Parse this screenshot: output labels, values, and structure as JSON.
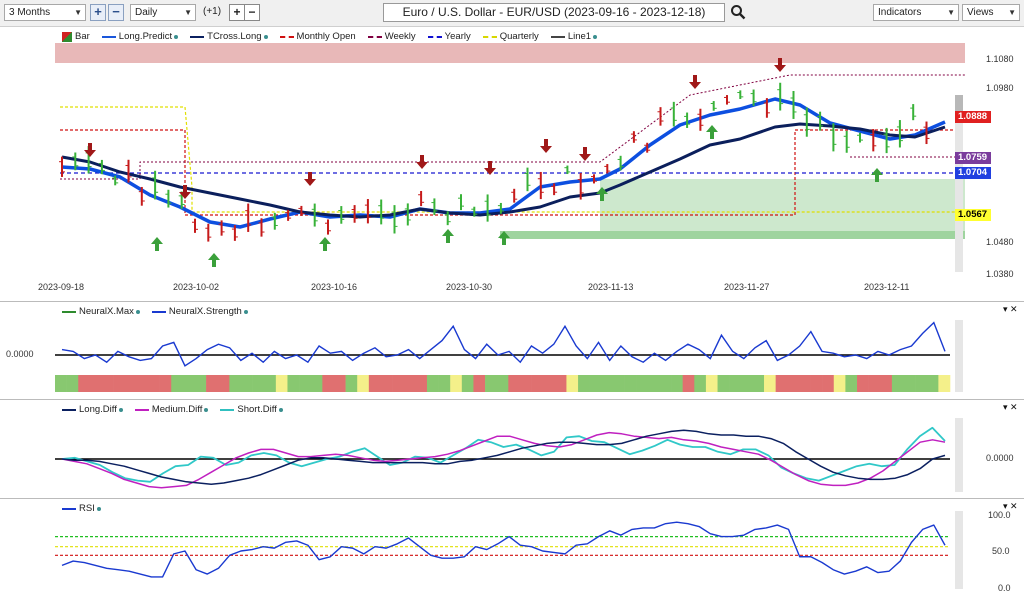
{
  "toolbar": {
    "range": "3 Months",
    "interval": "Daily",
    "offset": "(+1)",
    "title": "Euro / U.S. Dollar - EUR/USD (2023-09-16 - 2023-12-18)",
    "indicators": "Indicators",
    "views": "Views"
  },
  "main_legend": [
    {
      "label": "Bar",
      "color": "#2e8b2e",
      "style": "bar"
    },
    {
      "label": "Long.Predict",
      "color": "#1a56db",
      "style": "solid"
    },
    {
      "label": "TCross.Long",
      "color": "#0b2060",
      "style": "solid"
    },
    {
      "label": "Monthly Open",
      "color": "#d01010",
      "style": "dashed"
    },
    {
      "label": "Weekly",
      "color": "#800040",
      "style": "dashed"
    },
    {
      "label": "Yearly",
      "color": "#1010d0",
      "style": "dashed"
    },
    {
      "label": "Quarterly",
      "color": "#d8d800",
      "style": "dashed"
    },
    {
      "label": "Line1",
      "color": "#444444",
      "style": "solid"
    }
  ],
  "price_axis": [
    "1.1080",
    "1.0980",
    "1.0480",
    "1.0380"
  ],
  "price_tags": [
    {
      "value": "1.0888",
      "bg": "#e02020",
      "fg": "#ffffff"
    },
    {
      "value": "1.0759",
      "bg": "#7a3c9c",
      "fg": "#ffffff"
    },
    {
      "value": "1.0704",
      "bg": "#2040e0",
      "fg": "#ffffff"
    },
    {
      "value": "1.0567",
      "bg": "#ffff30",
      "fg": "#000000"
    }
  ],
  "date_axis": [
    "2023-09-18",
    "2023-10-02",
    "2023-10-16",
    "2023-10-30",
    "2023-11-13",
    "2023-11-27",
    "2023-12-11"
  ],
  "neural_legend": [
    {
      "label": "NeuralX.Max",
      "color": "#2e8b2e"
    },
    {
      "label": "NeuralX.Strength",
      "color": "#1a3ad0"
    }
  ],
  "neural_axis": "0.0000",
  "diff_legend": [
    {
      "label": "Long.Diff",
      "color": "#0b2060"
    },
    {
      "label": "Medium.Diff",
      "color": "#c020c0"
    },
    {
      "label": "Short.Diff",
      "color": "#30c0c0"
    }
  ],
  "diff_axis": "0.0000",
  "rsi_legend": [
    {
      "label": "RSI",
      "color": "#1a3ad0"
    }
  ],
  "rsi_axis": [
    "100.0",
    "50.0",
    "0.0"
  ],
  "neural_strength": [
    0.3,
    0.2,
    -0.2,
    0.0,
    -0.4,
    0.2,
    -0.1,
    -0.3,
    -0.2,
    0.5,
    0.7,
    -0.6,
    -0.2,
    0.3,
    0.6,
    0.4,
    -0.3,
    0.1,
    -0.4,
    0.2,
    -0.2,
    0.0,
    -0.4,
    0.5,
    0.1,
    0.2,
    -0.3,
    0.1,
    0.4,
    -0.1,
    0.0,
    0.3,
    -0.2,
    0.3,
    0.8,
    1.6,
    0.3,
    -0.2,
    0.6,
    0.0,
    0.2,
    -0.4,
    0.5,
    0.1,
    0.6,
    1.6,
    0.5,
    -0.2,
    0.7,
    -0.3,
    0.5,
    -0.1,
    -0.4,
    0.1,
    -0.3,
    0.2,
    0.6,
    0.3,
    -0.2,
    1.1,
    0.2,
    -0.2,
    0.4,
    0.8,
    -0.3,
    0.0,
    0.5,
    1.3,
    0.2,
    0.1,
    -0.1,
    0.0,
    -0.2,
    0.2,
    0.0,
    0.3,
    0.5,
    1.2,
    1.8,
    0.2
  ],
  "neural_colors": [
    "g",
    "g",
    "r",
    "r",
    "r",
    "r",
    "r",
    "r",
    "r",
    "r",
    "g",
    "g",
    "g",
    "r",
    "r",
    "g",
    "g",
    "g",
    "g",
    "y",
    "g",
    "g",
    "g",
    "r",
    "r",
    "g",
    "y",
    "r",
    "r",
    "r",
    "r",
    "r",
    "g",
    "g",
    "y",
    "g",
    "r",
    "g",
    "g",
    "r",
    "r",
    "r",
    "r",
    "r",
    "y",
    "g",
    "g",
    "g",
    "g",
    "g",
    "g",
    "g",
    "g",
    "g",
    "r",
    "g",
    "y",
    "g",
    "g",
    "g",
    "g",
    "y",
    "r",
    "r",
    "r",
    "r",
    "r",
    "y",
    "g",
    "r",
    "r",
    "r",
    "g",
    "g",
    "g",
    "g",
    "y"
  ],
  "long_diff": [
    0.0,
    -0.1,
    -0.1,
    -0.2,
    -0.4,
    -0.6,
    -0.9,
    -1.2,
    -1.5,
    -1.7,
    -1.9,
    -2.0,
    -2.1,
    -2.0,
    -1.8,
    -1.6,
    -1.3,
    -0.9,
    -0.5,
    -0.1,
    0.1,
    0.1,
    0.0,
    -0.1,
    -0.2,
    -0.3,
    -0.3,
    -0.3,
    -0.3,
    -0.3,
    -0.4,
    -0.4,
    -0.2,
    -0.1,
    0.1,
    0.3,
    0.6,
    0.9,
    1.1,
    1.3,
    1.4,
    1.4,
    1.3,
    1.2,
    1.2,
    1.3,
    1.6,
    1.9,
    2.1,
    2.3,
    2.4,
    2.3,
    2.1,
    2.0,
    2.0,
    1.9,
    1.9,
    1.7,
    1.3,
    0.6,
    0.0,
    -0.6,
    -1.1,
    -1.4,
    -1.6,
    -1.7,
    -1.7,
    -1.6,
    -1.3,
    -0.8,
    0.0,
    0.3
  ],
  "medium_diff": [
    0.0,
    -0.2,
    -0.4,
    -0.8,
    -1.2,
    -1.7,
    -2.0,
    -2.3,
    -2.4,
    -2.3,
    -2.2,
    -1.7,
    -1.1,
    -0.5,
    0.1,
    0.5,
    0.8,
    0.8,
    0.5,
    0.2,
    0.2,
    0.3,
    0.4,
    0.3,
    0.1,
    -0.1,
    -0.2,
    -0.1,
    0.0,
    0.1,
    0.2,
    0.4,
    0.7,
    1.1,
    1.5,
    1.9,
    1.9,
    1.6,
    1.3,
    1.1,
    1.0,
    1.2,
    1.6,
    2.0,
    2.2,
    2.1,
    1.9,
    1.8,
    1.7,
    1.8,
    1.6,
    1.5,
    1.3,
    1.0,
    0.8,
    0.6,
    0.4,
    -0.1,
    -0.7,
    -1.3,
    -1.8,
    -2.1,
    -2.2,
    -2.2,
    -2.0,
    -1.6,
    -1.0,
    -0.2,
    0.6,
    1.4,
    1.6,
    1.4
  ],
  "short_diff": [
    0.0,
    0.1,
    -0.2,
    -0.5,
    -1.1,
    -1.6,
    -1.8,
    -1.9,
    -1.2,
    -0.6,
    -0.5,
    0.2,
    0.1,
    -0.5,
    -0.3,
    0.3,
    0.5,
    0.3,
    -0.3,
    -0.6,
    -0.3,
    0.0,
    0.2,
    0.6,
    0.9,
    0.2,
    -0.5,
    -0.3,
    0.2,
    0.1,
    -0.3,
    0.3,
    0.9,
    1.6,
    1.4,
    1.0,
    1.2,
    0.8,
    0.3,
    0.6,
    1.8,
    1.9,
    1.5,
    1.4,
    0.9,
    0.4,
    0.7,
    1.1,
    1.6,
    1.2,
    1.0,
    1.0,
    0.6,
    0.4,
    0.8,
    0.8,
    0.3,
    -0.7,
    -1.2,
    -1.6,
    -1.8,
    -1.4,
    -1.0,
    -0.6,
    -0.4,
    -0.6,
    -0.5,
    0.8,
    1.9,
    2.6,
    1.5
  ],
  "rsi": [
    30,
    36,
    34,
    30,
    26,
    24,
    22,
    18,
    14,
    14,
    46,
    50,
    24,
    18,
    26,
    44,
    50,
    52,
    56,
    54,
    62,
    64,
    58,
    38,
    42,
    56,
    54,
    46,
    56,
    54,
    60,
    68,
    56,
    44,
    40,
    40,
    42,
    56,
    52,
    60,
    70,
    58,
    56,
    50,
    48,
    46,
    58,
    60,
    70,
    78,
    72,
    80,
    82,
    82,
    88,
    90,
    88,
    84,
    74,
    70,
    70,
    72,
    80,
    82,
    86,
    80,
    42,
    42,
    34,
    24,
    18,
    22,
    28,
    20,
    22,
    36,
    62,
    80,
    86,
    58
  ]
}
